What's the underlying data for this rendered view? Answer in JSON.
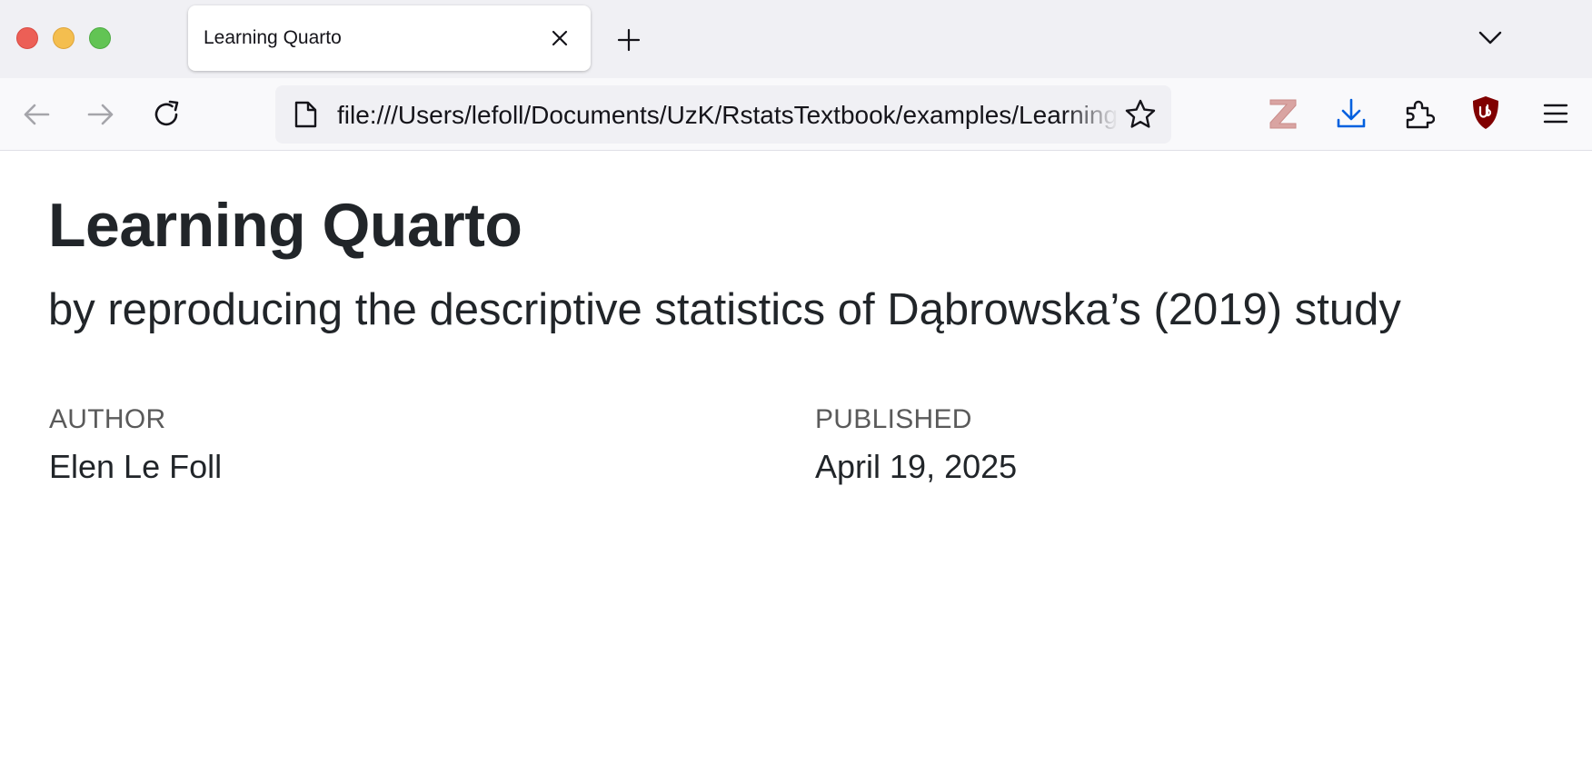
{
  "browser": {
    "tab": {
      "title": "Learning Quarto",
      "close_icon": "close-icon"
    },
    "new_tab_icon": "plus-icon",
    "tab_list_icon": "chevron-down-icon",
    "nav": {
      "back_icon": "back-arrow-icon",
      "forward_icon": "forward-arrow-icon",
      "reload_icon": "reload-icon"
    },
    "url": "file:///Users/lefoll/Documents/UzK/RstatsTextbook/examples/LearningQuarto.html",
    "toolbar_icons": [
      "zotero-icon",
      "download-icon",
      "extensions-icon",
      "ublock-shield-icon",
      "menu-icon"
    ],
    "colors": {
      "download_blue": "#0060df",
      "zotero_red": "#d9a4a2",
      "ublock_red": "#800000"
    }
  },
  "page": {
    "title": "Learning Quarto",
    "subtitle": "by reproducing the descriptive statistics of Dąbrowska’s (2019) study",
    "meta": {
      "author_heading": "AUTHOR",
      "author": "Elen Le Foll",
      "published_heading": "PUBLISHED",
      "published": "April 19, 2025"
    }
  }
}
